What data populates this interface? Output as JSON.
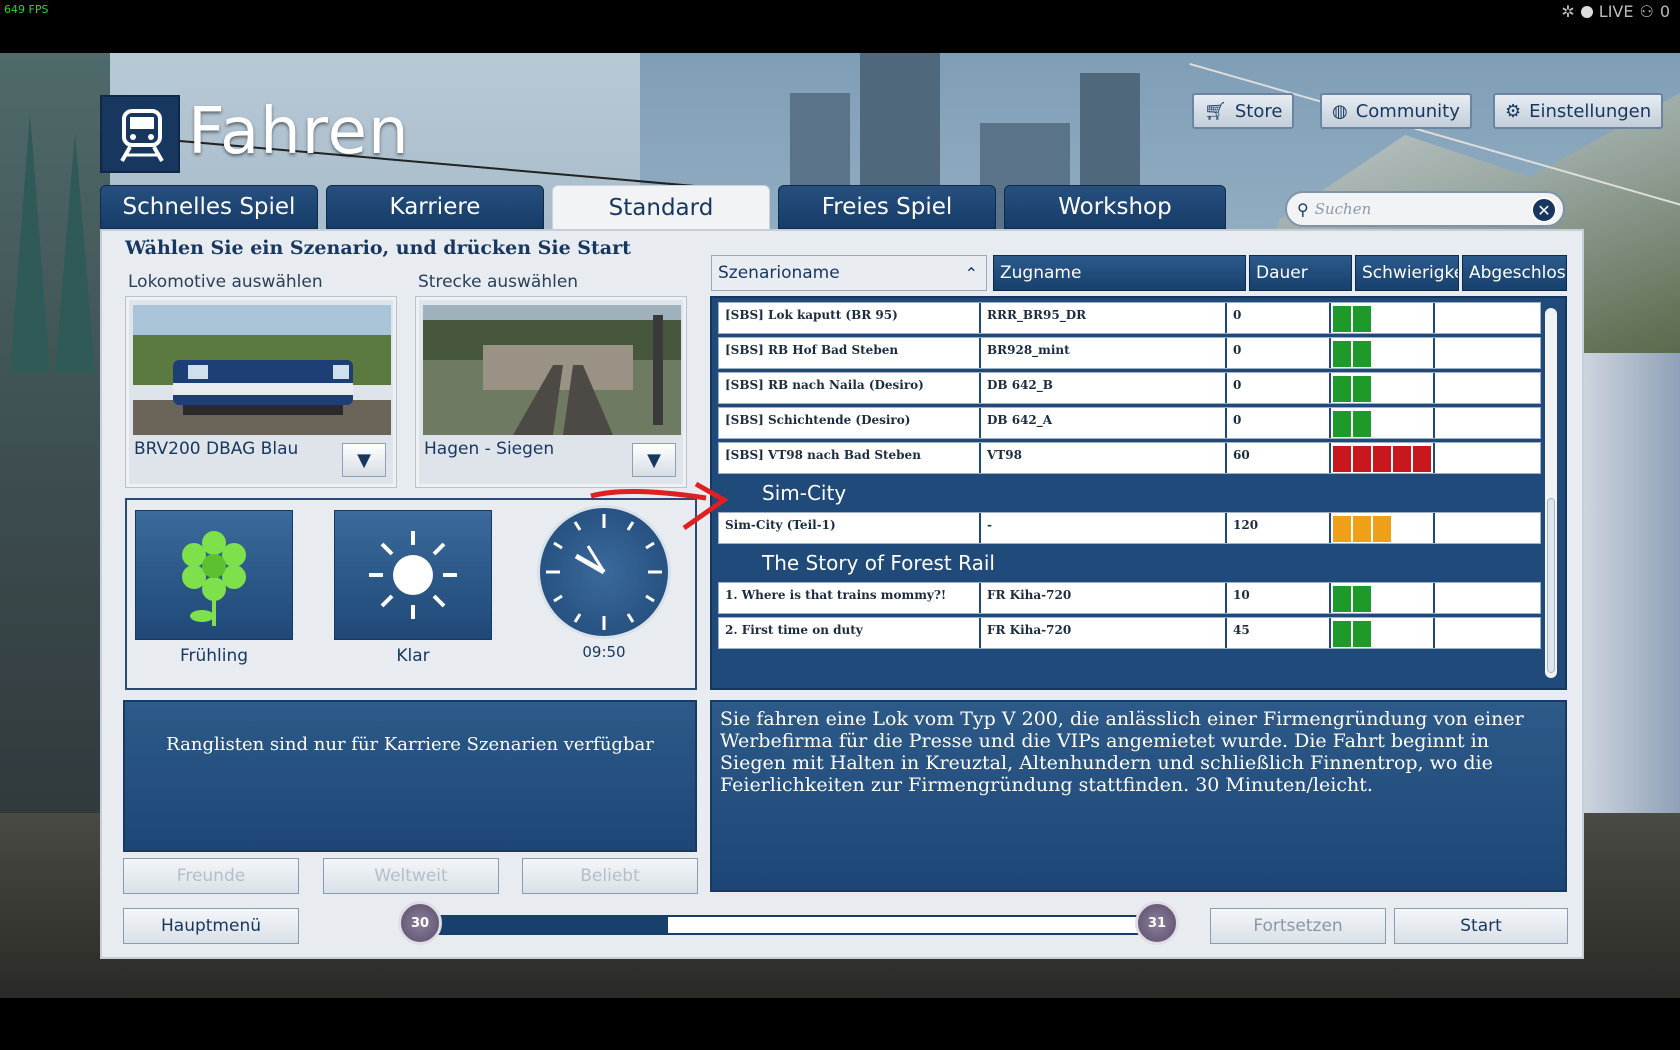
{
  "overlay": {
    "fps": "649 FPS",
    "live": "LIVE",
    "viewers": "0"
  },
  "header": {
    "title": "Fahren",
    "store": "Store",
    "community": "Community",
    "settings": "Einstellungen"
  },
  "tabs": [
    "Schnelles Spiel",
    "Karriere",
    "Standard",
    "Freies Spiel",
    "Workshop"
  ],
  "search": {
    "placeholder": "Suchen"
  },
  "main": {
    "heading": "Wählen Sie ein Szenario, und drücken Sie Start",
    "loco_label": "Lokomotive auswählen",
    "route_label": "Strecke auswählen",
    "loco_name": "BRV200 DBAG Blau",
    "route_name": "Hagen - Siegen",
    "leaderboard_msg": "Ranglisten sind nur für Karriere Szenarien verfügbar",
    "friends": "Freunde",
    "worldwide": "Weltweit",
    "popular": "Beliebt"
  },
  "conditions": {
    "season": "Frühling",
    "weather": "Klar",
    "time": "09:50"
  },
  "table": {
    "columns": [
      "Szenarioname",
      "Zugname",
      "Dauer",
      "Schwierigke",
      "Abgeschlos"
    ],
    "entries": [
      {
        "kind": "row",
        "name": "[SBS] Lok kaputt (BR 95)",
        "train": "RRR_BR95_DR",
        "duration": "0",
        "difficulty": 2,
        "difficulty_color": "green"
      },
      {
        "kind": "row",
        "name": "[SBS] RB Hof Bad Steben",
        "train": "BR928_mint",
        "duration": "0",
        "difficulty": 2,
        "difficulty_color": "green"
      },
      {
        "kind": "row",
        "name": "[SBS] RB nach Naila (Desiro)",
        "train": "DB 642_B",
        "duration": "0",
        "difficulty": 2,
        "difficulty_color": "green"
      },
      {
        "kind": "row",
        "name": "[SBS] Schichtende (Desiro)",
        "train": "DB 642_A",
        "duration": "0",
        "difficulty": 2,
        "difficulty_color": "green"
      },
      {
        "kind": "row",
        "name": "[SBS] VT98 nach Bad Steben",
        "train": "VT98",
        "duration": "60",
        "difficulty": 5,
        "difficulty_color": "red"
      },
      {
        "kind": "group",
        "name": "Sim-City"
      },
      {
        "kind": "row",
        "name": "Sim-City (Teil-1)",
        "train": "-",
        "duration": "120",
        "difficulty": 3,
        "difficulty_color": "orange"
      },
      {
        "kind": "group",
        "name": "The Story of Forest Rail"
      },
      {
        "kind": "row",
        "name": "1. Where is that trains mommy?!",
        "train": "FR Kiha-720",
        "duration": "10",
        "difficulty": 2,
        "difficulty_color": "green"
      },
      {
        "kind": "row",
        "name": "2. First time on duty",
        "train": "FR Kiha-720",
        "duration": "45",
        "difficulty": 2,
        "difficulty_color": "green"
      }
    ]
  },
  "colors": {
    "green": "#1e9a2a",
    "red": "#c8181e",
    "orange": "#f0a018"
  },
  "description": "Sie fahren eine Lok vom Typ V 200, die anlässlich einer Firmengründung von einer Werbefirma für die Presse und die VIPs angemietet wurde. Die Fahrt beginnt in Siegen mit Halten in Kreuztal, Altenhundern und schließlich Finnentrop, wo die Feierlichkeiten zur Firmengründung stattfinden. 30 Minuten/leicht.",
  "footer": {
    "main_menu": "Hauptmenü",
    "progress_left": "30",
    "progress_right": "31",
    "progress_fraction": 0.33,
    "continue": "Fortsetzen",
    "start": "Start"
  }
}
